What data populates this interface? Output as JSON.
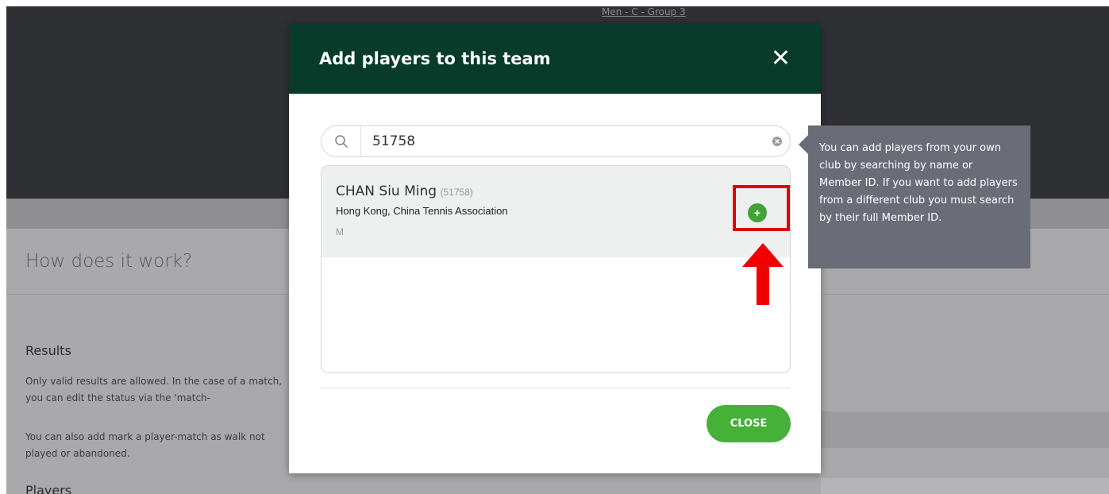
{
  "background": {
    "breadcrumb": "Men - C - Group 3",
    "how_title": "How does it work?",
    "results_title": "Results",
    "results_p1": "Only valid results are allowed. In the case of a match, you can edit the status via the 'match-",
    "results_p2": "You can also add mark a player-match as walk not played or abandoned.",
    "players_title": "Players"
  },
  "modal": {
    "title": "Add players to this team",
    "close_icon": "close-icon",
    "search": {
      "value": "51758",
      "placeholder": "",
      "icon": "search-icon"
    },
    "results": [
      {
        "name": "CHAN Siu Ming",
        "member_id": "(51758)",
        "club": "Hong Kong, China Tennis Association",
        "gender": "M",
        "add_icon": "plus-icon"
      }
    ],
    "close_button": "CLOSE"
  },
  "tooltip": {
    "text": "You can add players from your own club by searching by name or Member ID. If you want to add players from a different club you must search by their full Member ID."
  },
  "colors": {
    "header": "#083b2a",
    "accent_green": "#45b138",
    "highlight_red": "#e00000",
    "tooltip_bg": "#6a6d77"
  }
}
